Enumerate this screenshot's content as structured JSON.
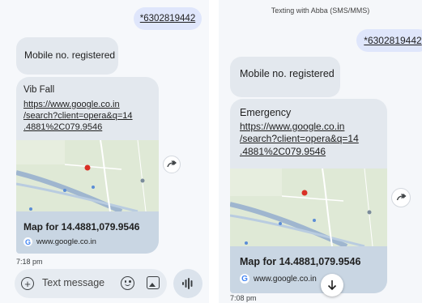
{
  "colors": {
    "outgoing_bubble": "#dfe6fb",
    "incoming_bubble": "#e3e8ee",
    "map_caption_bg": "#c9d6e3",
    "map_land": "#dfe9d6",
    "map_road": "#9fb6cf",
    "map_pin": "#d93025"
  },
  "left": {
    "outgoing_number": "*6302819442",
    "registered_message": "Mobile no. registered",
    "card": {
      "title": "Vib Fall",
      "link_lines": [
        "https://www.google.co.in",
        "/search?client=opera&q=14",
        ".4881%2C079.9546"
      ],
      "map_title": "Map for 14.4881,079.9546",
      "source": "www.google.co.in",
      "source_icon": "google-g-icon"
    },
    "share_icon": "forward-share-icon",
    "timestamp": "7:18 pm",
    "compose": {
      "placeholder": "Text message",
      "add_icon": "plus-icon",
      "emoji_icon": "emoji-icon",
      "gallery_icon": "gallery-icon",
      "voice_icon": "voice-waveform-icon"
    }
  },
  "right": {
    "header_title": "Texting with Abba (SMS/MMS)",
    "outgoing_number": "*6302819442",
    "registered_message": "Mobile no. registered",
    "card": {
      "title": "Emergency",
      "link_lines": [
        "https://www.google.co.in",
        "/search?client=opera&q=14",
        ".4881%2C079.9546"
      ],
      "map_title": "Map for 14.4881,079.9546",
      "source": "www.google.co.in",
      "source_icon": "google-g-icon"
    },
    "share_icon": "forward-share-icon",
    "scroll_icon": "arrow-down-icon",
    "timestamp": "7:08 pm"
  }
}
